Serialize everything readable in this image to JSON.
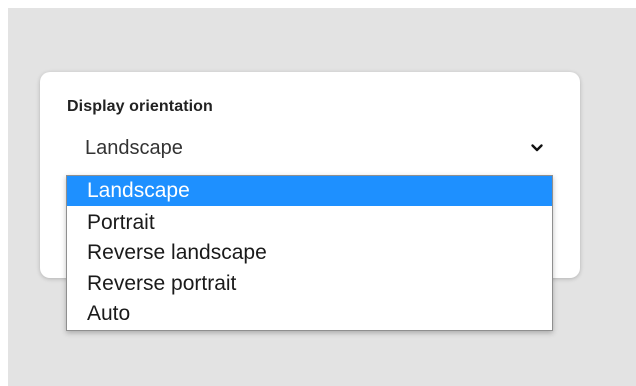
{
  "setting": {
    "label": "Display orientation",
    "selected_value": "Landscape",
    "chevron_icon": "chevron-down-icon"
  },
  "dropdown": {
    "highlight_color": "#1e90ff",
    "options": [
      {
        "label": "Landscape",
        "selected": true
      },
      {
        "label": "Portrait",
        "selected": false
      },
      {
        "label": "Reverse landscape",
        "selected": false
      },
      {
        "label": "Reverse portrait",
        "selected": false
      },
      {
        "label": "Auto",
        "selected": false
      }
    ]
  }
}
